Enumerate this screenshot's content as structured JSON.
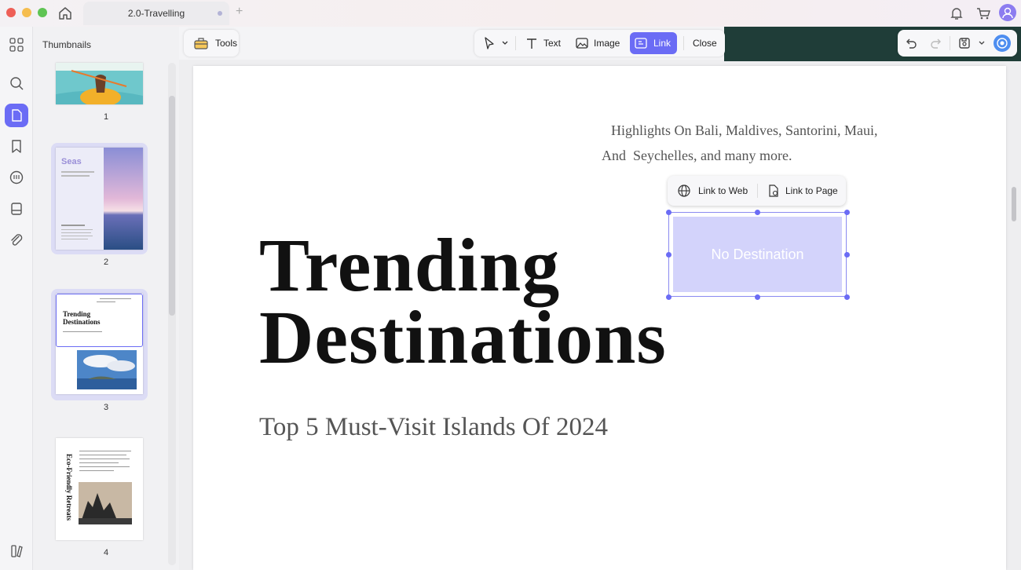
{
  "window": {
    "tab_title": "2.0-Travelling",
    "new_tab": "+"
  },
  "thumbnails": {
    "title": "Thumbnails",
    "pages": [
      {
        "number": "1"
      },
      {
        "number": "2",
        "heading": "Seas"
      },
      {
        "number": "3",
        "heading_line1": "Trending",
        "heading_line2": "Destinations"
      },
      {
        "number": "4",
        "vertical_text": "Eco-Friendly Retreats"
      }
    ]
  },
  "toolbar": {
    "tools_label": "Tools",
    "text_label": "Text",
    "image_label": "Image",
    "link_label": "Link",
    "close_label": "Close"
  },
  "page": {
    "highlights_line1": "Highlights On Bali, Maldives, Santorini, Maui,",
    "highlights_line2": "And  Seychelles, and many more.",
    "title_line1": "Trending",
    "title_line2": "Destinations",
    "subtitle": "Top 5 Must-Visit Islands Of 2024"
  },
  "link_popup": {
    "web_label": "Link to Web",
    "page_label": "Link to Page",
    "placeholder": "No Destination"
  },
  "colors": {
    "accent": "#6b6cf5",
    "link_fill": "#d3d3fb",
    "dark_strip": "#1f3d38"
  }
}
